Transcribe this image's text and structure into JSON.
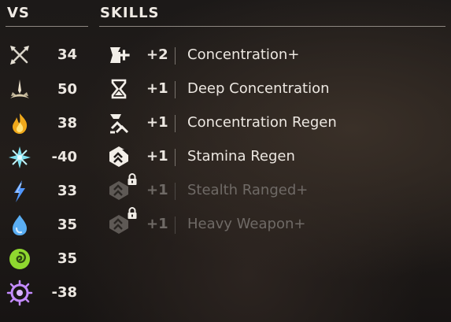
{
  "headers": {
    "vs": "VS",
    "skills": "SKILLS"
  },
  "vs": [
    {
      "icon": "tear-icon",
      "value": "34",
      "color": "#d6d2c8"
    },
    {
      "icon": "impact-icon",
      "value": "50",
      "color": "#e8dcc4"
    },
    {
      "icon": "fire-icon",
      "value": "38",
      "color": "#f2b21f"
    },
    {
      "icon": "freeze-icon",
      "value": "-40",
      "color": "#7fe0f0"
    },
    {
      "icon": "shock-icon",
      "value": "33",
      "color": "#5aa0ff"
    },
    {
      "icon": "frost-icon",
      "value": "35",
      "color": "#63b6f5"
    },
    {
      "icon": "acid-icon",
      "value": "35",
      "color": "#9ee23a"
    },
    {
      "icon": "purgewater-icon",
      "value": "-38",
      "color": "#c48bff"
    }
  ],
  "skills": [
    {
      "icon": "concentration-plus-icon",
      "value": "+2",
      "name": "Concentration+",
      "locked": false
    },
    {
      "icon": "hourglass-icon",
      "value": "+1",
      "name": "Deep Concentration",
      "locked": false
    },
    {
      "icon": "regen-arrows-icon",
      "value": "+1",
      "name": "Concentration Regen",
      "locked": false
    },
    {
      "icon": "stamina-regen-icon",
      "value": "+1",
      "name": "Stamina Regen",
      "locked": false
    },
    {
      "icon": "stealth-ranged-icon",
      "value": "+1",
      "name": "Stealth Ranged+",
      "locked": true
    },
    {
      "icon": "heavy-weapon-icon",
      "value": "+1",
      "name": "Heavy Weapon+",
      "locked": true
    }
  ]
}
